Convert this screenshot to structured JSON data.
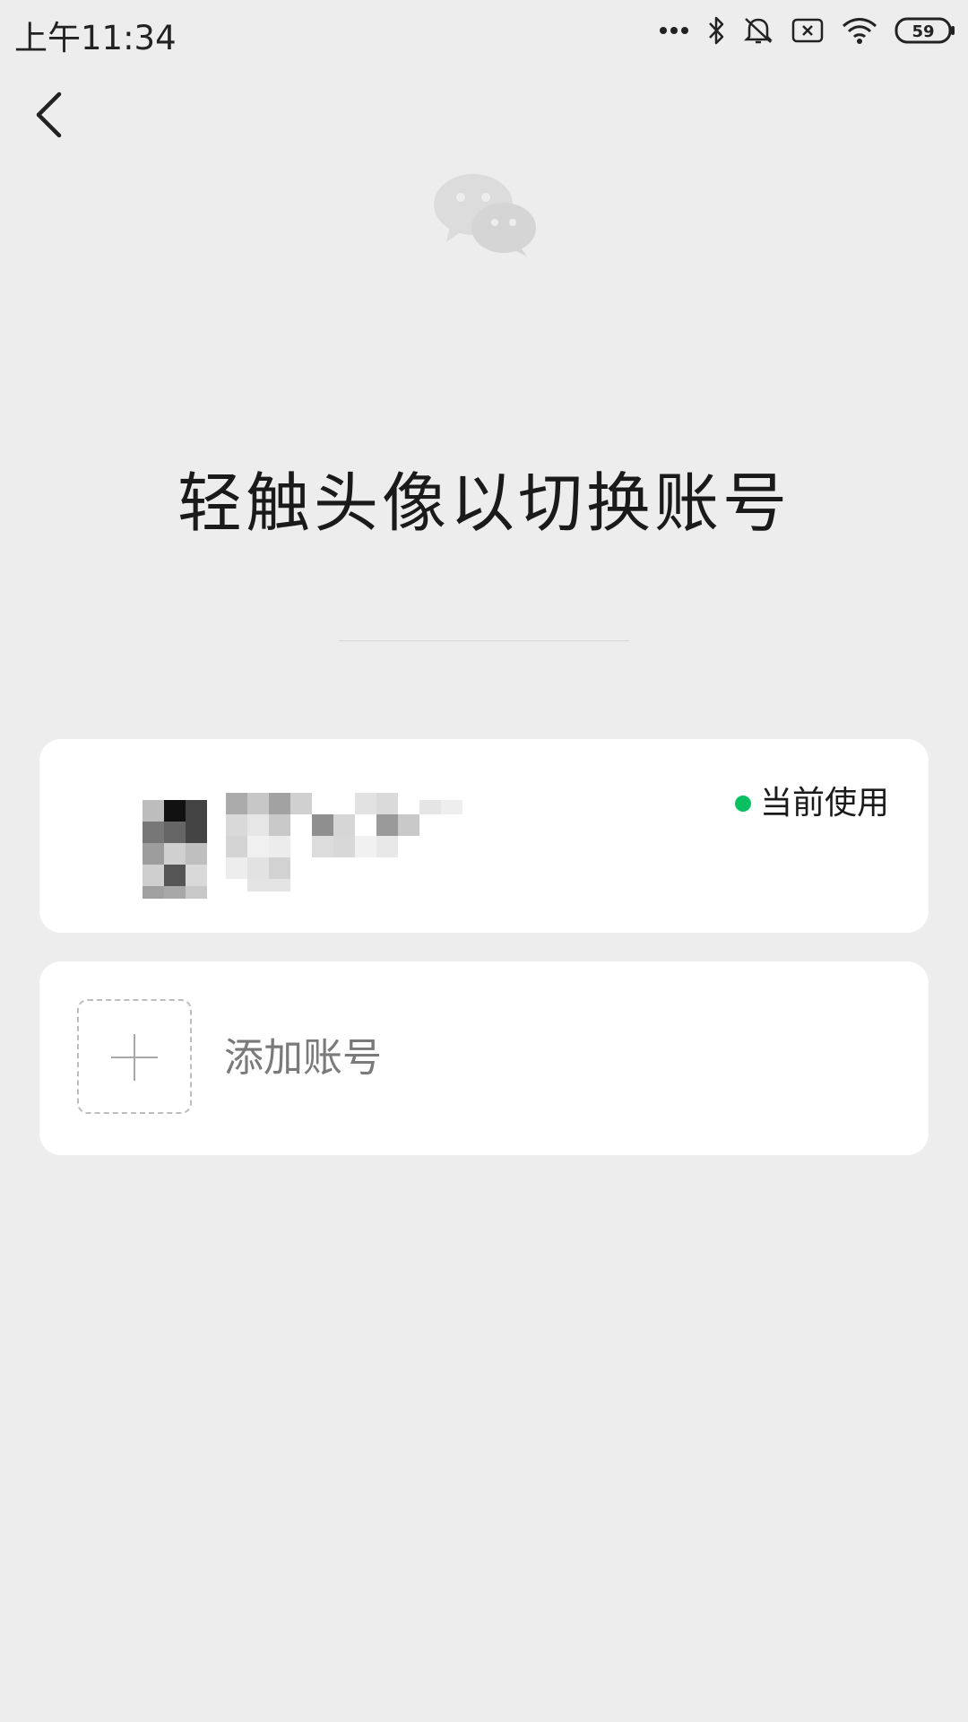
{
  "status_bar": {
    "time": "上午11:34",
    "battery": "59",
    "icons": [
      "more-dots-icon",
      "bluetooth-icon",
      "mute-icon",
      "sim-off-icon",
      "wifi-icon",
      "battery-icon"
    ]
  },
  "header": {
    "back_icon": "chevron-left-icon",
    "logo_icon": "wechat-logo-icon"
  },
  "title": "轻触头像以切换账号",
  "accounts": [
    {
      "name": "",
      "status": "当前使用",
      "status_color": "#07c160"
    }
  ],
  "add_account": {
    "label": "添加账号",
    "icon": "plus-icon"
  },
  "colors": {
    "background": "#ededed",
    "card": "#ffffff",
    "accent": "#07c160"
  }
}
